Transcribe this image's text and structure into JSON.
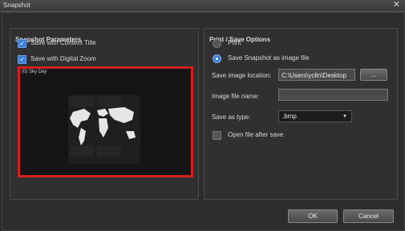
{
  "window": {
    "title": "Snapshot",
    "close_glyph": "✕"
  },
  "snapshot_params": {
    "title": "Snapshot Parameters",
    "save_content_title": {
      "label": "Save with Content Title",
      "checked": true
    },
    "save_digital_zoom": {
      "label": "Save with Digital Zoom",
      "checked": true
    },
    "preview_caption": "(0) Sky Day"
  },
  "print_options": {
    "title": "Print / Save Options",
    "print_label": "Print",
    "save_image_label": "Save Snapshot as image file",
    "selected": "save_image",
    "location_label": "Save image location:",
    "location_value": "C:\\Users\\yclin\\Desktop",
    "browse_label": "...",
    "filename_label": "Image file name:",
    "filename_value": "",
    "type_label": "Save as type:",
    "type_value": ".bmp",
    "open_after_label": "Open file after save",
    "open_after_checked": false
  },
  "buttons": {
    "ok": "OK",
    "cancel": "Cancel"
  },
  "colors": {
    "accent": "#3d7ed6",
    "preview_border": "#d21f1f"
  }
}
